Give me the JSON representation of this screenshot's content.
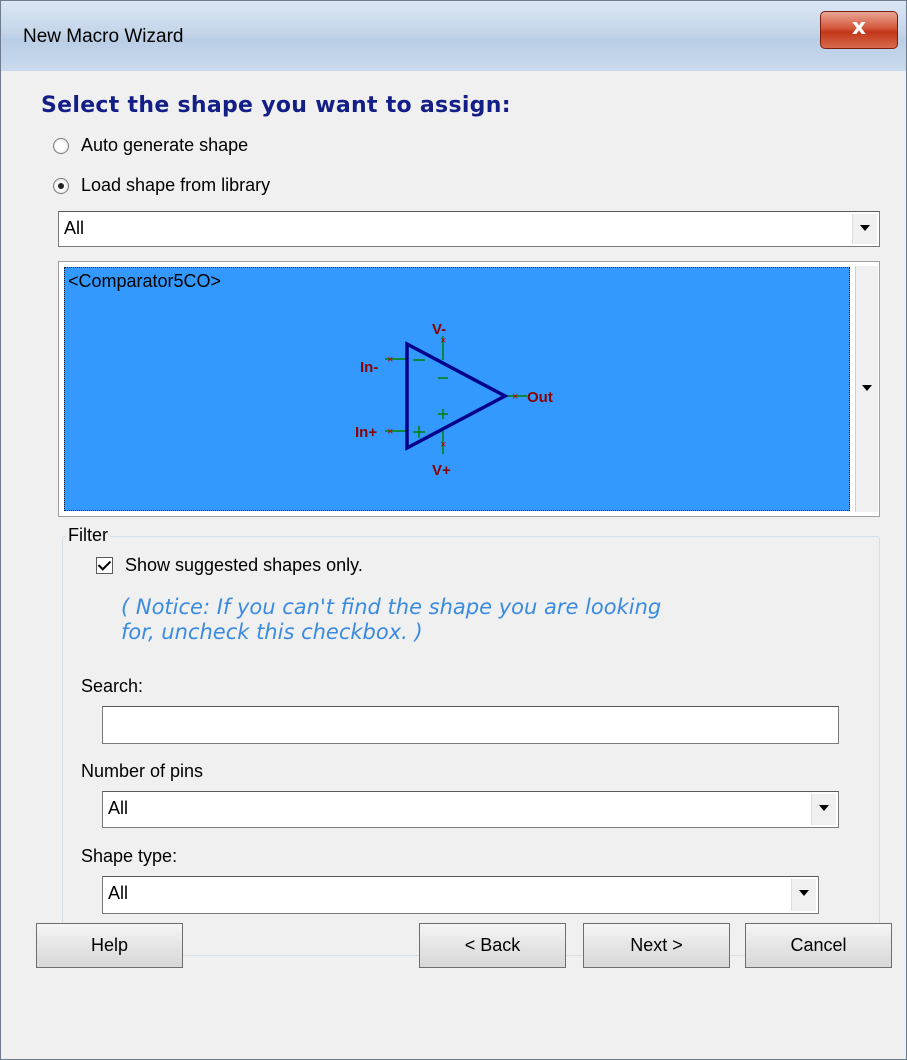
{
  "window": {
    "title": "New Macro Wizard",
    "close_label": "x"
  },
  "heading": "Select the shape you want to assign:",
  "options": {
    "auto_generate_label": "Auto generate shape",
    "load_from_library_label": "Load shape from library",
    "selected": "load_from_library"
  },
  "library_combo": {
    "value": "All"
  },
  "shape_preview": {
    "name": "<Comparator5CO>",
    "pins": {
      "v_minus": "V-",
      "v_plus": "V+",
      "in_minus": "In-",
      "in_plus": "In+",
      "out": "Out"
    },
    "colors": {
      "background": "#3399ff",
      "triangle": "#00008b",
      "pin_label": "#8b0000",
      "pin_line": "#008000"
    }
  },
  "filter": {
    "legend": "Filter",
    "suggested_label": "Show suggested shapes only.",
    "suggested_checked": true,
    "notice_line1": "( Notice: If you can't find the shape you are looking",
    "notice_line2": "for, uncheck this checkbox. )",
    "search_label": "Search:",
    "search_value": "",
    "pins_label": "Number of pins",
    "pins_value": "All",
    "shape_type_label": "Shape type:",
    "shape_type_value": "All"
  },
  "buttons": {
    "help": "Help",
    "back": "< Back",
    "next": "Next >",
    "cancel": "Cancel"
  }
}
